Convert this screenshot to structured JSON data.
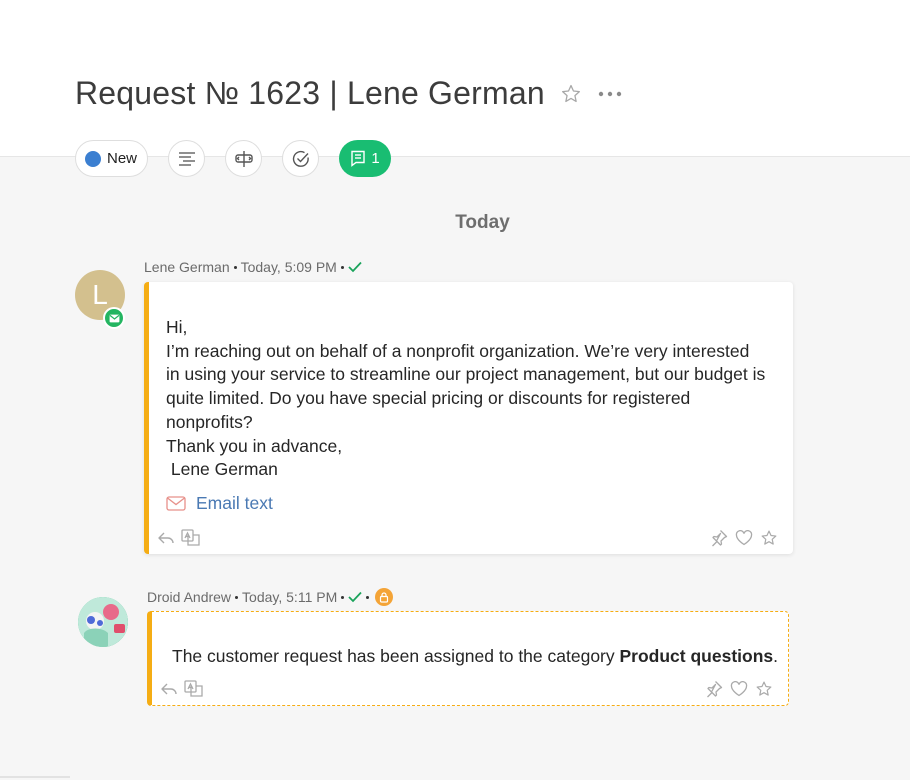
{
  "header": {
    "title": "Request № 1623 | Lene German",
    "star_icon": "star-outline-icon",
    "more_icon": "more-dots-icon"
  },
  "toolbar": {
    "status_label": "New",
    "status_color": "#3b7fd1",
    "buttons": [
      "details-icon",
      "split-icon",
      "check-circle-icon"
    ],
    "comments_count": "1",
    "comments_color": "#19bd72"
  },
  "feed": {
    "day_label": "Today",
    "messages": [
      {
        "author": "Lene German",
        "time": "Today, 5:09 PM",
        "avatar_letter": "L",
        "lines": [
          "Hi,",
          "I’m reaching out on behalf of a nonprofit organization. We’re very interested",
          "in using your service to streamline our project management, but our budget is",
          "quite limited. Do you have special pricing or discounts for registered",
          "nonprofits?",
          "Thank you in advance,",
          " Lene German"
        ],
        "email_link": "Email text"
      },
      {
        "author": "Droid Andrew",
        "time": "Today, 5:11 PM",
        "text_prefix": "The customer request has been assigned to the category ",
        "text_bold": "Product questions",
        "text_suffix": "."
      }
    ]
  },
  "colors": {
    "accent_bar": "#f5ad14",
    "link": "#4a79b3",
    "check": "#1aa35b"
  }
}
